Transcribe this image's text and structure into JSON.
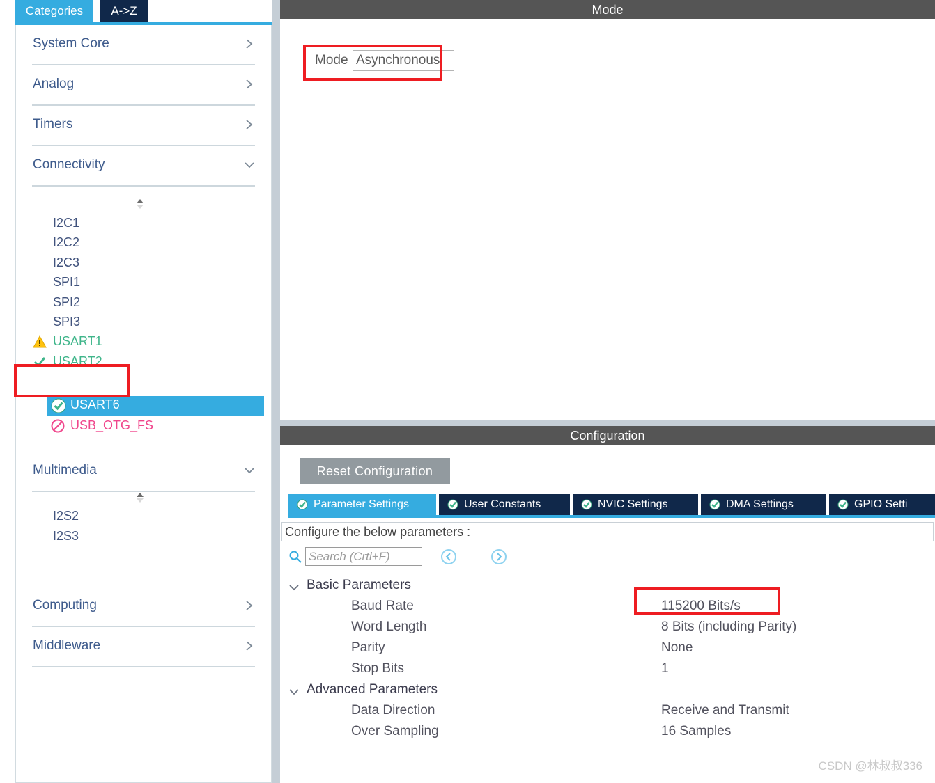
{
  "sidebar": {
    "tabs": [
      {
        "label": "Categories",
        "active": true
      },
      {
        "label": "A->Z",
        "active": false
      }
    ],
    "categories": [
      {
        "label": "System Core",
        "state": "collapsed"
      },
      {
        "label": "Analog",
        "state": "collapsed"
      },
      {
        "label": "Timers",
        "state": "collapsed"
      },
      {
        "label": "Connectivity",
        "state": "expanded"
      },
      {
        "label": "Multimedia",
        "state": "expanded"
      },
      {
        "label": "Computing",
        "state": "collapsed"
      },
      {
        "label": "Middleware",
        "state": "collapsed"
      }
    ],
    "connectivity_items": [
      {
        "label": "I2C1",
        "status": "none",
        "selected": false
      },
      {
        "label": "I2C2",
        "status": "none",
        "selected": false
      },
      {
        "label": "I2C3",
        "status": "none",
        "selected": false
      },
      {
        "label": "SPI1",
        "status": "none",
        "selected": false
      },
      {
        "label": "SPI2",
        "status": "none",
        "selected": false
      },
      {
        "label": "SPI3",
        "status": "none",
        "selected": false
      },
      {
        "label": "USART1",
        "status": "warning",
        "selected": false
      },
      {
        "label": "USART2",
        "status": "check",
        "selected": false
      },
      {
        "label": "USART6",
        "status": "ok",
        "selected": true
      },
      {
        "label": "USB_OTG_FS",
        "status": "disabled",
        "selected": false
      }
    ],
    "multimedia_items": [
      {
        "label": "I2S2",
        "status": "none",
        "selected": false
      },
      {
        "label": "I2S3",
        "status": "none",
        "selected": false
      }
    ]
  },
  "mode": {
    "header": "Mode",
    "field_label": "Mode",
    "field_value": "Asynchronous"
  },
  "configuration": {
    "header": "Configuration",
    "reset_button": "Reset Configuration",
    "tabs": [
      {
        "label": "Parameter Settings",
        "active": true
      },
      {
        "label": "User Constants",
        "active": false
      },
      {
        "label": "NVIC Settings",
        "active": false
      },
      {
        "label": "DMA Settings",
        "active": false
      },
      {
        "label": "GPIO Setti",
        "active": false
      }
    ],
    "note": "Configure the below parameters :",
    "search": {
      "value": "",
      "placeholder": "Search (Crtl+F)"
    },
    "groups": [
      {
        "label": "Basic Parameters",
        "expanded": true,
        "rows": [
          {
            "key": "Baud Rate",
            "value": "115200 Bits/s"
          },
          {
            "key": "Word Length",
            "value": "8 Bits (including Parity)"
          },
          {
            "key": "Parity",
            "value": "None"
          },
          {
            "key": "Stop Bits",
            "value": "1"
          }
        ]
      },
      {
        "label": "Advanced Parameters",
        "expanded": true,
        "rows": [
          {
            "key": "Data Direction",
            "value": "Receive and Transmit"
          },
          {
            "key": "Over Sampling",
            "value": "16 Samples"
          }
        ]
      }
    ]
  },
  "annotations": {
    "mode_field": "red-box-mode-field",
    "usart6": "red-box-usart6",
    "baud_rate": "red-box-baud-rate"
  },
  "watermark": "CSDN @林叔叔336",
  "colors": {
    "accent_blue": "#35ACE0",
    "tab_navy": "#10284A",
    "header_grey": "#555555",
    "annotation_red": "#EE1D22",
    "status_green": "#3FB58A",
    "status_pink": "#F0468C",
    "status_warning": "#FFC20E"
  }
}
